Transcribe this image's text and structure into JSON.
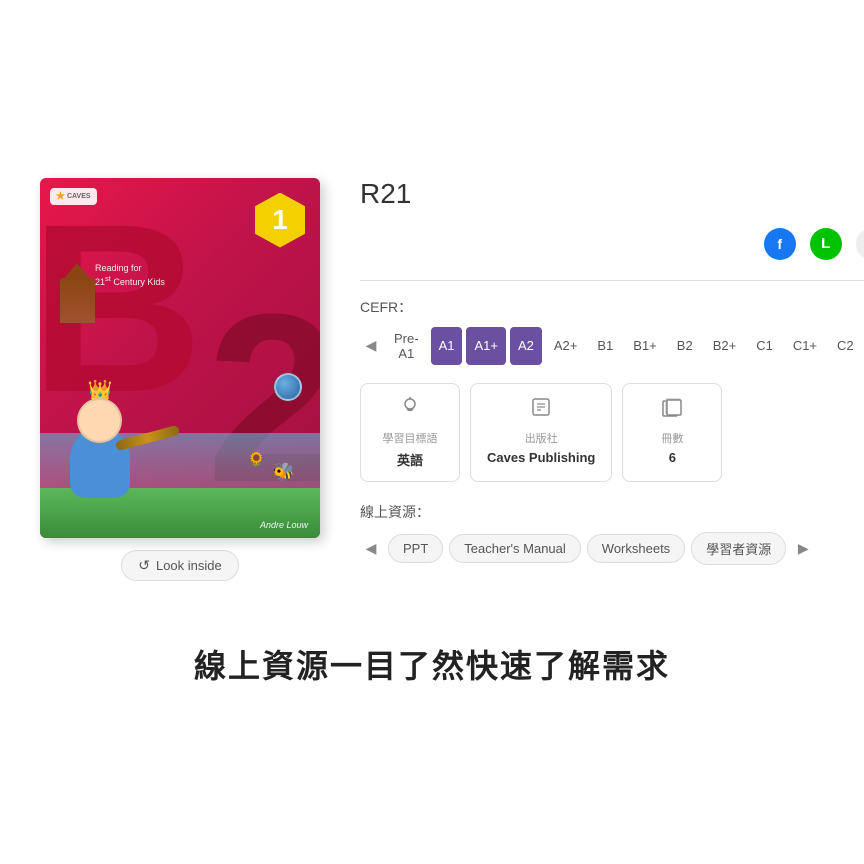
{
  "book": {
    "title": "R21",
    "author": "Andre Louw",
    "subtitle": "Reading for\n21st Century Kids",
    "volume_number": "1",
    "big_letter_1": "B",
    "big_letter_2": "2"
  },
  "social": {
    "facebook_label": "f",
    "line_label": "L",
    "link_label": "🔗"
  },
  "cefr": {
    "label": "CEFR：",
    "tags": [
      {
        "id": "pre-a1",
        "label": "Pre-A1",
        "active": false
      },
      {
        "id": "a1",
        "label": "A1",
        "active": true
      },
      {
        "id": "a1plus",
        "label": "A1+",
        "active": true
      },
      {
        "id": "a2",
        "label": "A2",
        "active": true
      },
      {
        "id": "a2plus",
        "label": "A2+",
        "active": false
      },
      {
        "id": "b1",
        "label": "B1",
        "active": false
      },
      {
        "id": "b1plus",
        "label": "B1+",
        "active": false
      },
      {
        "id": "b2",
        "label": "B2",
        "active": false
      },
      {
        "id": "b2plus",
        "label": "B2+",
        "active": false
      },
      {
        "id": "c1",
        "label": "C1",
        "active": false
      },
      {
        "id": "c1plus",
        "label": "C1+",
        "active": false
      },
      {
        "id": "c2",
        "label": "C2",
        "active": false
      }
    ]
  },
  "info_cards": [
    {
      "id": "subject",
      "icon": "💡",
      "label": "學習目標語",
      "value": "英語"
    },
    {
      "id": "publisher",
      "icon": "📋",
      "label": "出版社",
      "value": "Caves Publishing"
    },
    {
      "id": "volumes",
      "icon": "📚",
      "label": "冊數",
      "value": "6"
    }
  ],
  "resources": {
    "label": "線上資源：",
    "items": [
      {
        "id": "ppt",
        "label": "PPT",
        "active": false
      },
      {
        "id": "teachers-manual",
        "label": "Teacher's Manual",
        "active": false
      },
      {
        "id": "worksheets",
        "label": "Worksheets",
        "active": false
      },
      {
        "id": "learner-resources",
        "label": "學習者資源",
        "active": false
      }
    ]
  },
  "look_inside": {
    "label": "Look inside"
  },
  "tagline": {
    "text": "線上資源一目了然快速了解需求"
  },
  "ui": {
    "nav_left": "◀",
    "nav_right": "▶"
  }
}
